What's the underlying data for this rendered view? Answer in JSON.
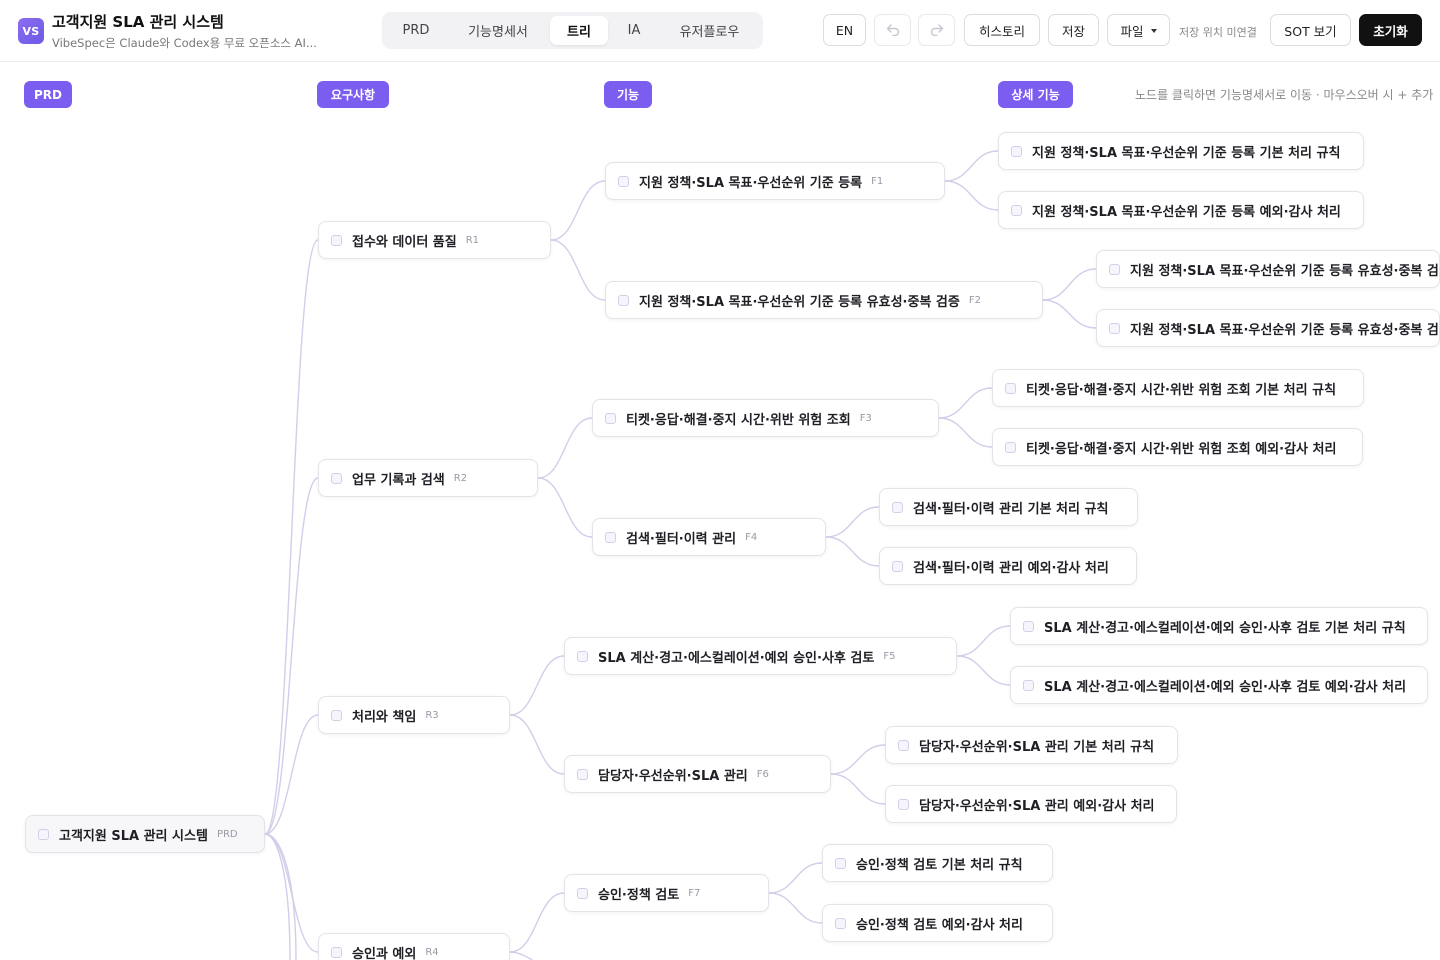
{
  "header": {
    "logo_text": "VS",
    "title": "고객지원 SLA 관리 시스템",
    "subtitle": "VibeSpec은 Claude와 Codex용 무료 오픈소스 AI...",
    "tabs": [
      {
        "label": "PRD",
        "active": false
      },
      {
        "label": "기능명세서",
        "active": false
      },
      {
        "label": "트리",
        "active": true
      },
      {
        "label": "IA",
        "active": false
      },
      {
        "label": "유저플로우",
        "active": false
      }
    ],
    "lang_button": "EN",
    "undo_icon": "undo-icon",
    "redo_icon": "redo-icon",
    "history_button": "히스토리",
    "save_button": "저장",
    "file_menu": "파일",
    "save_status": "저장 위치 미연결",
    "sot_button": "SOT 보기",
    "reset_button": "초기화"
  },
  "columns": [
    "PRD",
    "요구사항",
    "기능",
    "상세 기능"
  ],
  "hint": "노드를 클릭하면 기능명세서로 이동 · 마우스오버 시 + 추가",
  "colors": {
    "accent": "#7b5df0",
    "edge": "#d3cdea"
  },
  "tree": {
    "root": {
      "label": "고객지원 SLA 관리 시스템",
      "code": "PRD"
    },
    "requirements": [
      {
        "label": "접수와 데이터 품질",
        "code": "R1"
      },
      {
        "label": "업무 기록과 검색",
        "code": "R2"
      },
      {
        "label": "처리와 책임",
        "code": "R3"
      },
      {
        "label": "승인과 예외",
        "code": "R4"
      }
    ],
    "features": [
      {
        "label": "지원 정책·SLA 목표·우선순위 기준 등록",
        "code": "F1"
      },
      {
        "label": "지원 정책·SLA 목표·우선순위 기준 등록 유효성·중복 검증",
        "code": "F2"
      },
      {
        "label": "티켓·응답·해결·중지 시간·위반 위험 조회",
        "code": "F3"
      },
      {
        "label": "검색·필터·이력 관리",
        "code": "F4"
      },
      {
        "label": "SLA 계산·경고·에스컬레이션·예외 승인·사후 검토",
        "code": "F5"
      },
      {
        "label": "담당자·우선순위·SLA 관리",
        "code": "F6"
      },
      {
        "label": "승인·정책 검토",
        "code": "F7"
      }
    ],
    "details": [
      {
        "label": "지원 정책·SLA 목표·우선순위 기준 등록 기본 처리 규칙"
      },
      {
        "label": "지원 정책·SLA 목표·우선순위 기준 등록 예외·감사 처리"
      },
      {
        "label": "지원 정책·SLA 목표·우선순위 기준 등록 유효성·중복 검증 기본 처리 규칙"
      },
      {
        "label": "지원 정책·SLA 목표·우선순위 기준 등록 유효성·중복 검증 예외·감사 처리"
      },
      {
        "label": "티켓·응답·해결·중지 시간·위반 위험 조회 기본 처리 규칙"
      },
      {
        "label": "티켓·응답·해결·중지 시간·위반 위험 조회 예외·감사 처리"
      },
      {
        "label": "검색·필터·이력 관리 기본 처리 규칙"
      },
      {
        "label": "검색·필터·이력 관리 예외·감사 처리"
      },
      {
        "label": "SLA 계산·경고·에스컬레이션·예외 승인·사후 검토 기본 처리 규칙"
      },
      {
        "label": "SLA 계산·경고·에스컬레이션·예외 승인·사후 검토 예외·감사 처리"
      },
      {
        "label": "담당자·우선순위·SLA 관리 기본 처리 규칙"
      },
      {
        "label": "담당자·우선순위·SLA 관리 예외·감사 처리"
      },
      {
        "label": "승인·정책 검토 기본 처리 규칙"
      },
      {
        "label": "승인·정책 검토 예외·감사 처리"
      }
    ]
  }
}
